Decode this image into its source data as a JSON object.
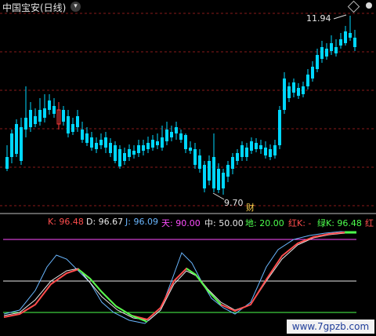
{
  "window": {
    "title": "中国宝安(日线)",
    "dropdown_glyph": "▾"
  },
  "main_panel": {
    "high_label": "11.94",
    "low_label": "9.70",
    "signal_label": "财"
  },
  "indicator_row": {
    "k": {
      "label": "K: 96.48",
      "color": "#ff4d4d"
    },
    "d": {
      "label": "D: 96.67",
      "color": "#e8e8e8"
    },
    "j": {
      "label": "J: 96.09",
      "color": "#6ab7ff"
    },
    "tian": {
      "label": "天: 90.00",
      "color": "#ff4dff"
    },
    "zhong": {
      "label": "中: 50.00",
      "color": "#e8e8e8"
    },
    "di": {
      "label": "地: 20.00",
      "color": "#4dff4d"
    },
    "hongk": {
      "label": "红K: -",
      "color": "#ff4d4d"
    },
    "lvk": {
      "label": "绿K: 96.48",
      "color": "#4dff4d"
    },
    "hong": {
      "label": "红",
      "color": "#ff4d4d"
    }
  },
  "watermark": {
    "text": "www.7gpzb.com"
  },
  "colors": {
    "up": "#ff3b3b",
    "down": "#00d7ff",
    "grid": "#8a1a1a",
    "background": "#000000"
  }
}
